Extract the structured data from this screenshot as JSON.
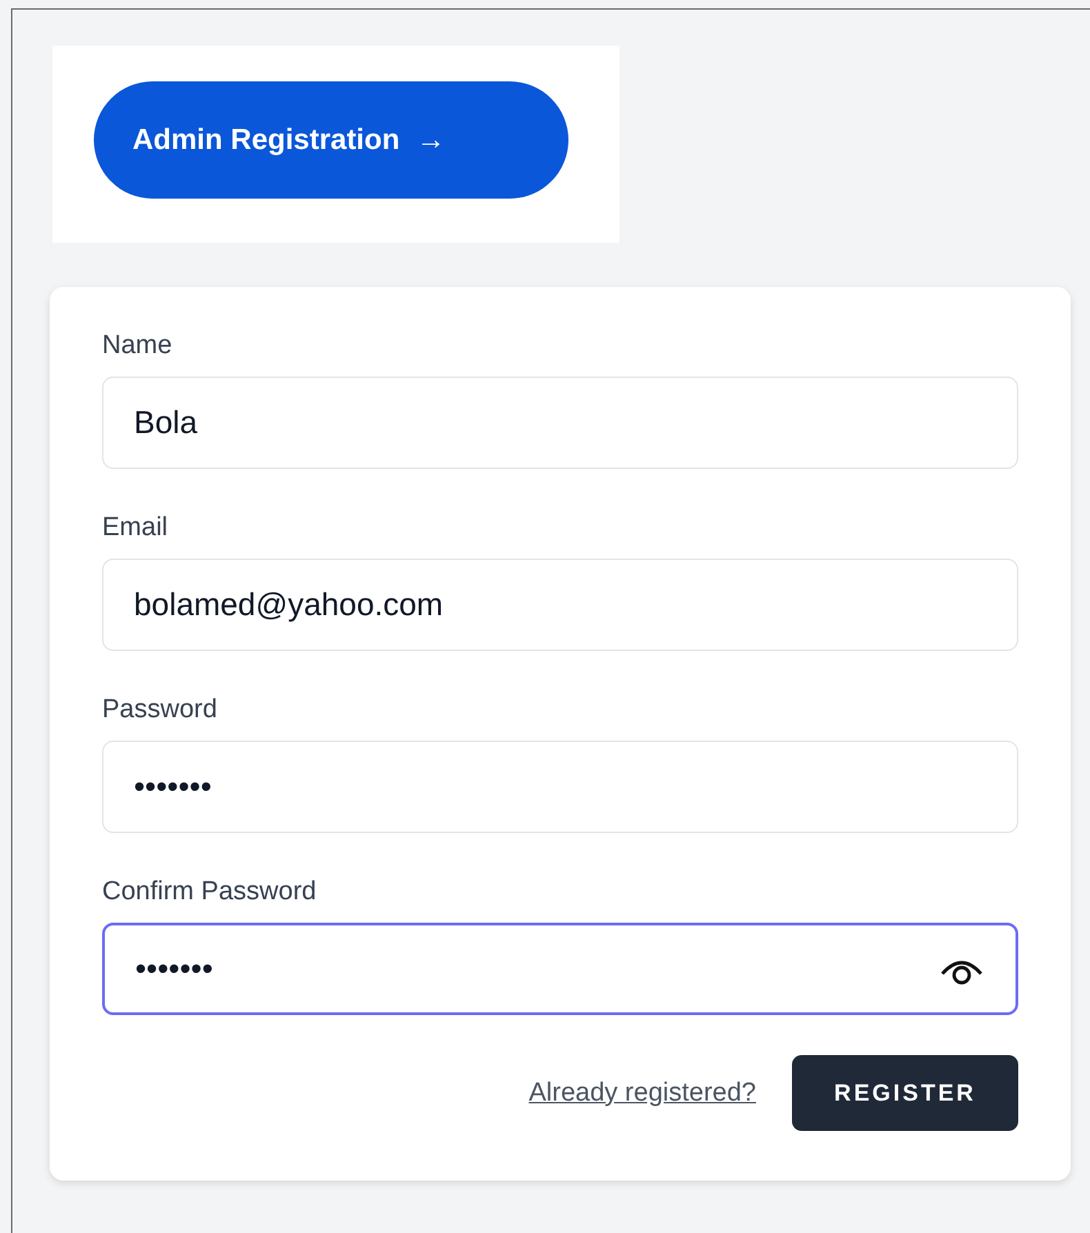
{
  "header_button": {
    "label": "Admin Registration",
    "arrow": "→"
  },
  "fields": [
    {
      "label": "Name",
      "value": "Bola",
      "focused": false,
      "reveal_toggle": false
    },
    {
      "label": "Email",
      "value": "bolamed@yahoo.com",
      "focused": false,
      "reveal_toggle": false
    },
    {
      "label": "Password",
      "value": "•••••••",
      "focused": false,
      "reveal_toggle": false
    },
    {
      "label": "Confirm Password",
      "value": "•••••••",
      "focused": true,
      "reveal_toggle": true
    }
  ],
  "login_link": "Already registered?",
  "submit_button": "REGISTER"
}
